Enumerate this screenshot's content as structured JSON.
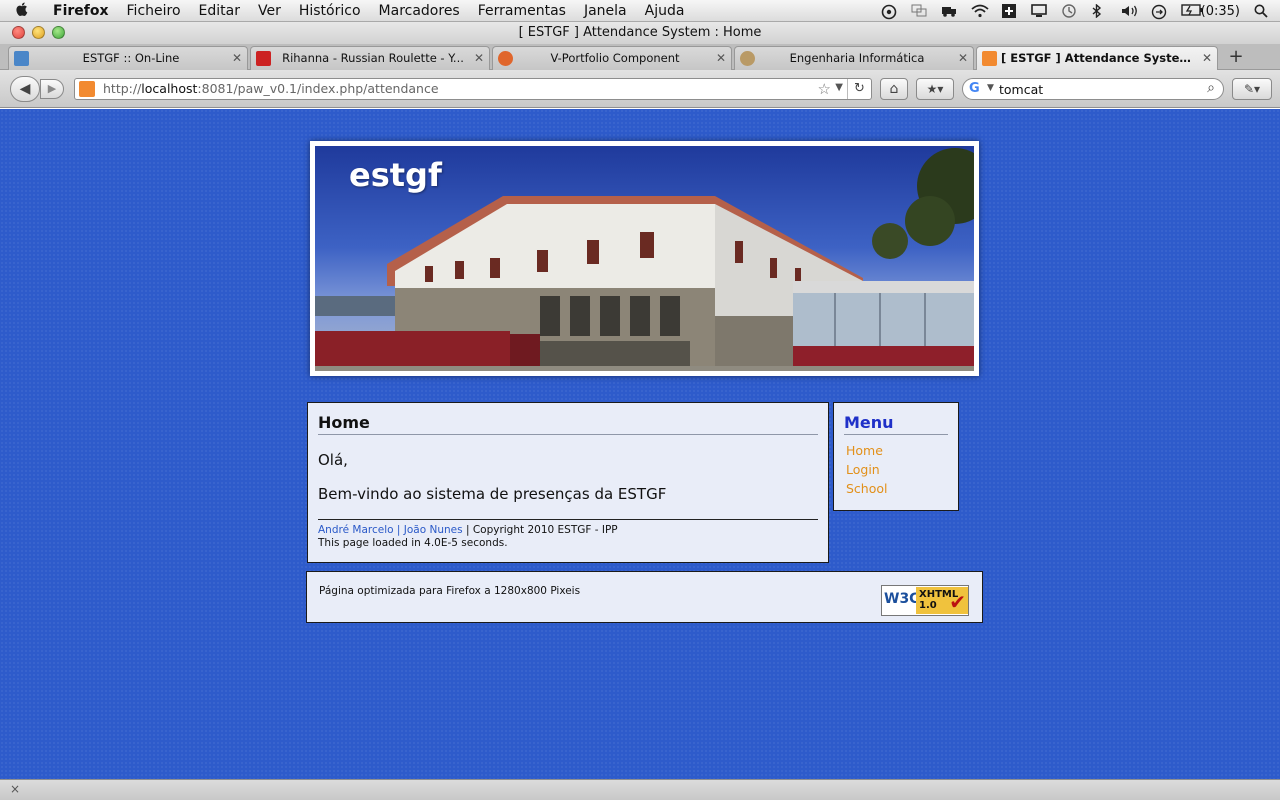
{
  "menubar": {
    "apple": "",
    "items": [
      "Firefox",
      "Ficheiro",
      "Editar",
      "Ver",
      "Histórico",
      "Marcadores",
      "Ferramentas",
      "Janela",
      "Ajuda"
    ],
    "battery": "(0:35)"
  },
  "window": {
    "title": "[ ESTGF ] Attendance System : Home"
  },
  "tabs": [
    {
      "title": "ESTGF :: On-Line",
      "favicon": "book-icon",
      "color": "#4a86c8"
    },
    {
      "title": "Rihanna - Russian Roulette - Y...",
      "favicon": "youtube-icon",
      "color": "#cc2222"
    },
    {
      "title": "V-Portfolio Component",
      "favicon": "joomla-icon",
      "color": "#e0662c"
    },
    {
      "title": "Engenharia Informática",
      "favicon": "seal-icon",
      "color": "#b99a66"
    },
    {
      "title": "[ ESTGF ] Attendance System : ...",
      "favicon": "xampp-icon",
      "color": "#f28a30",
      "active": true
    }
  ],
  "newtab": "+",
  "navbar": {
    "url_prefix": "http://",
    "url_host": "localhost",
    "url_rest": ":8081/paw_v0.1/index.php/attendance",
    "search_value": "tomcat"
  },
  "banner": {
    "logo": "estgf"
  },
  "main": {
    "heading": "Home",
    "greeting": "Olá,",
    "welcome": "Bem-vindo ao sistema de presenças da ESTGF",
    "author1": "André Marcelo",
    "separator": "|",
    "author2": "João Nunes",
    "copyright": "| Copyright 2010 ESTGF - IPP",
    "loadtime": "This page loaded in 4.0E-5 seconds."
  },
  "menu": {
    "heading": "Menu",
    "links": [
      "Home",
      "Login",
      "School"
    ]
  },
  "optimized": {
    "text": "Página optimizada para Firefox a 1280x800 Pixeis",
    "badge_w3c": "W3C",
    "badge_label": "XHTML",
    "badge_version": "1.0"
  },
  "statusbar": {
    "close": "×"
  }
}
